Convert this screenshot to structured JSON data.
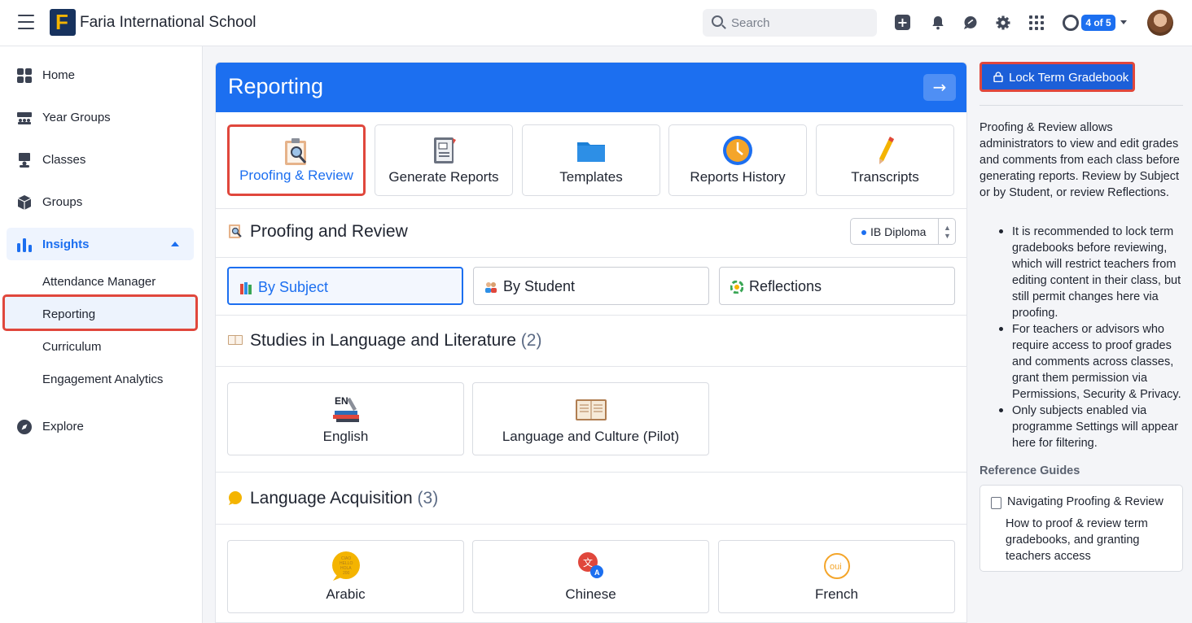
{
  "header": {
    "logo_letter": "F",
    "school_name": "Faria International School",
    "search_placeholder": "Search",
    "help_badge": "4 of 5",
    "icons": [
      "menu-icon",
      "plus-icon",
      "bell-icon",
      "chat-icon",
      "gear-icon",
      "apps-grid-icon",
      "help-icon",
      "avatar"
    ]
  },
  "sidebar": {
    "items": [
      {
        "label": "Home",
        "icon": "home-grid-icon"
      },
      {
        "label": "Year Groups",
        "icon": "year-groups-icon"
      },
      {
        "label": "Classes",
        "icon": "classes-icon"
      },
      {
        "label": "Groups",
        "icon": "groups-cube-icon"
      },
      {
        "label": "Insights",
        "icon": "bar-chart-icon",
        "active": true
      },
      {
        "label": "Explore",
        "icon": "compass-icon"
      }
    ],
    "insights_sub": [
      "Attendance Manager",
      "Reporting",
      "Curriculum",
      "Engagement Analytics"
    ],
    "highlighted_sub": "Reporting"
  },
  "main": {
    "title": "Reporting",
    "tabs": [
      {
        "label": "Proofing & Review",
        "icon": "proofing-icon",
        "active": true
      },
      {
        "label": "Generate Reports",
        "icon": "report-cards-icon"
      },
      {
        "label": "Templates",
        "icon": "folder-icon"
      },
      {
        "label": "Reports History",
        "icon": "clock-icon"
      },
      {
        "label": "Transcripts",
        "icon": "pencil-icon"
      }
    ],
    "section_title": "Proofing and Review",
    "programme_select": "IB Diploma",
    "view_toggle": [
      {
        "label": "By Subject",
        "active": true
      },
      {
        "label": "By Student"
      },
      {
        "label": "Reflections"
      }
    ],
    "groups": [
      {
        "title": "Studies in Language and Literature",
        "count": "(2)",
        "subjects": [
          {
            "name": "English",
            "icon": "english-books-icon"
          },
          {
            "name": "Language and Culture (Pilot)",
            "icon": "open-book-icon"
          }
        ]
      },
      {
        "title": "Language Acquisition",
        "count": "(3)",
        "subjects": [
          {
            "name": "Arabic",
            "icon": "speech-bubble-icon"
          },
          {
            "name": "Chinese",
            "icon": "translate-icon"
          },
          {
            "name": "French",
            "icon": "oui-icon"
          }
        ]
      }
    ]
  },
  "right_panel": {
    "lock_button": "Lock Term Gradebook",
    "description": "Proofing & Review allows administrators to view and edit grades and comments from each class before generating reports. Review by Subject or by Student, or review Reflections.",
    "bullets": [
      "It is recommended to lock term gradebooks before reviewing, which will restrict teachers from editing content in their class, but still permit changes here via proofing.",
      "For teachers or advisors who require access to proof grades and comments across classes, grant them permission via Permissions, Security & Privacy.",
      "Only subjects enabled via programme Settings will appear here for filtering."
    ],
    "reference_title": "Reference Guides",
    "guide": {
      "title": "Navigating Proofing & Review",
      "description": "How to proof & review term gradebooks, and granting teachers access"
    }
  },
  "colors": {
    "accent": "#1c6ff0",
    "highlight": "#e0473c",
    "brand_navy": "#17325e",
    "brand_gold": "#f4b400"
  }
}
